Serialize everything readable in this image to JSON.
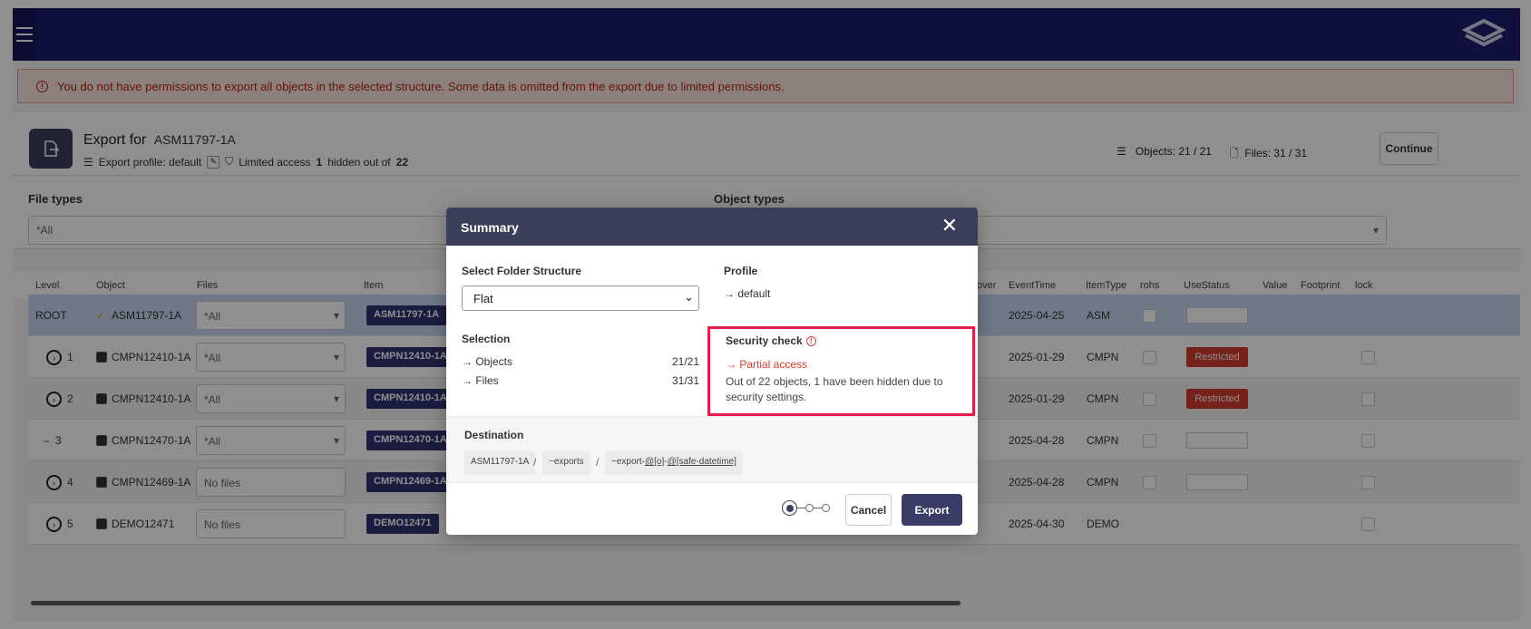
{
  "banner": {
    "message": "You do not have permissions to export all objects in the selected structure. Some data is omitted from the export due to limited permissions."
  },
  "header": {
    "title": "Export for",
    "object_code": "ASM11797-1A",
    "profile_text": "Export profile: default",
    "access_label": "Limited access",
    "hidden_count": "1",
    "hidden_text": "hidden out of",
    "total": "22",
    "objects_stat": "Objects: 21 / 21",
    "files_stat": "Files: 31 / 31",
    "continue_label": "Continue"
  },
  "filters": {
    "file_types_label": "File types",
    "file_types_value": "*All",
    "object_types_label": "Object types",
    "object_types_value": ""
  },
  "table": {
    "columns": [
      "Level",
      "Object",
      "Files",
      "Item",
      "over",
      "EventTime",
      "ItemType",
      "rohs",
      "UseStatus",
      "Value",
      "Footprint",
      "lock"
    ],
    "rows": [
      {
        "level": "ROOT",
        "object": "ASM11797-1A",
        "files": "*All",
        "item": "ASM11797-1A",
        "time": "2025-04-25",
        "type": "ASM",
        "status": ""
      },
      {
        "level": "1",
        "object": "CMPN12410-1A",
        "files": "*All",
        "item": "CMPN12410-1A",
        "time": "2025-01-29",
        "type": "CMPN",
        "status": "Restricted"
      },
      {
        "level": "2",
        "object": "CMPN12410-1A",
        "files": "*All",
        "item": "CMPN12410-1A",
        "time": "2025-01-29",
        "type": "CMPN",
        "status": "Restricted"
      },
      {
        "level": "3",
        "object": "CMPN12470-1A",
        "files": "*All",
        "item": "CMPN12470-1A",
        "time": "2025-04-28",
        "type": "CMPN",
        "status": ""
      },
      {
        "level": "4",
        "object": "CMPN12469-1A",
        "files": "No files",
        "item": "CMPN12469-1A",
        "time": "2025-04-28",
        "type": "CMPN",
        "status": ""
      },
      {
        "level": "5",
        "object": "DEMO12471",
        "files": "No files",
        "item": "DEMO12471",
        "time": "2025-04-30",
        "type": "DEMO",
        "status": ""
      }
    ]
  },
  "modal": {
    "title": "Summary",
    "folder_label": "Select Folder Structure",
    "folder_value": "Flat",
    "profile_label": "Profile",
    "profile_value": "→ default",
    "selection_label": "Selection",
    "objects_label": "→  Objects",
    "objects_value": "21/21",
    "files_label": "→  Files",
    "files_value": "31/31",
    "security_label": "Security check",
    "partial_access": "→ Partial access",
    "security_desc": "Out of 22 objects, 1 have been hidden due to security settings.",
    "destination_label": "Destination",
    "dest_root": "ASM11797-1A",
    "dest_folder": "~exports",
    "dest_file_prefix": "~export-",
    "dest_file_token1": "@[o]",
    "dest_file_sep": "-",
    "dest_file_token2": "@[safe-datetime]",
    "cancel_label": "Cancel",
    "export_label": "Export"
  },
  "colors": {
    "topbar": "#1b1d6e",
    "danger": "#d23b2f",
    "highlight": "#e51d48",
    "modal_header": "#3a3e58"
  }
}
